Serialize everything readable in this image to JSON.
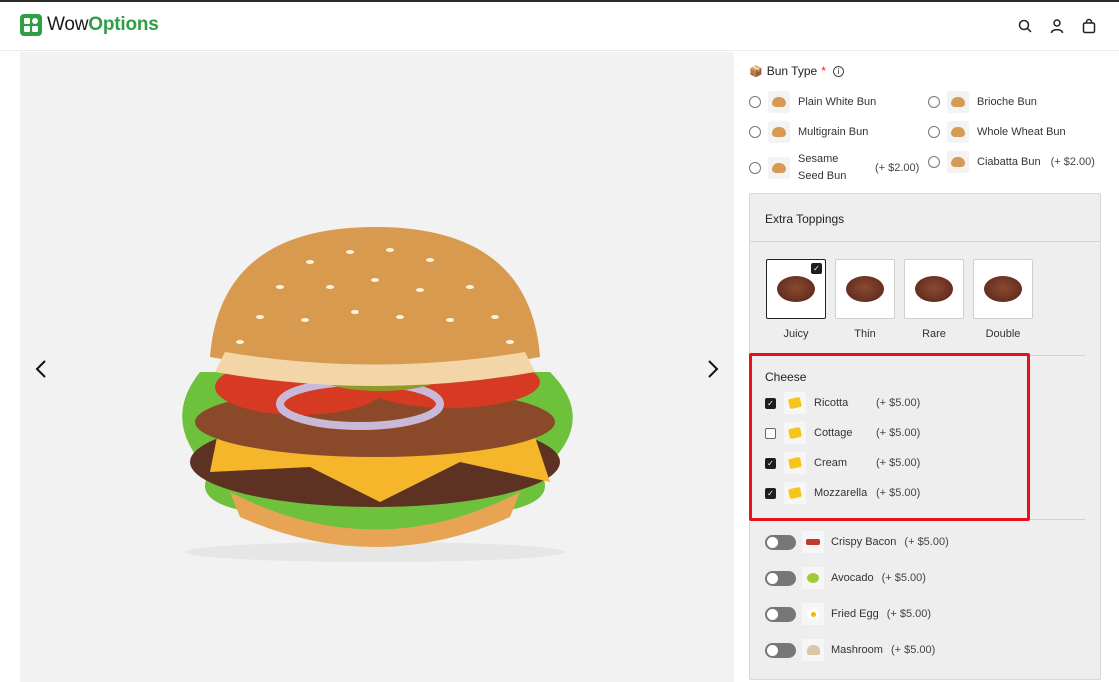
{
  "brand": {
    "prefix": "Wow",
    "accent": "Options",
    "color": "#2f9e44"
  },
  "header": {
    "icons": [
      "search-icon",
      "user-icon",
      "cart-icon"
    ]
  },
  "gallery": {
    "prev_icon": "chevron-left-icon",
    "next_icon": "chevron-right-icon"
  },
  "bun": {
    "label": "Bun Type",
    "required": "*",
    "options": [
      {
        "label": "Plain White Bun",
        "price": ""
      },
      {
        "label": "Brioche Bun",
        "price": ""
      },
      {
        "label": "Multigrain Bun",
        "price": ""
      },
      {
        "label": "Whole Wheat Bun",
        "price": ""
      },
      {
        "label": "Sesame Seed Bun",
        "price": "(+ $2.00)"
      },
      {
        "label": "Ciabatta Bun",
        "price": "(+ $2.00)"
      }
    ]
  },
  "toppings": {
    "title": "Extra Toppings",
    "patties": [
      {
        "label": "Juicy",
        "selected": true
      },
      {
        "label": "Thin",
        "selected": false
      },
      {
        "label": "Rare",
        "selected": false
      },
      {
        "label": "Double",
        "selected": false
      }
    ],
    "cheese": {
      "title": "Cheese",
      "items": [
        {
          "label": "Ricotta",
          "price": "(+ $5.00)",
          "checked": true
        },
        {
          "label": "Cottage",
          "price": "(+ $5.00)",
          "checked": false
        },
        {
          "label": "Cream",
          "price": "(+ $5.00)",
          "checked": true
        },
        {
          "label": "Mozzarella",
          "price": "(+ $5.00)",
          "checked": true
        }
      ]
    },
    "extras": [
      {
        "label": "Crispy Bacon",
        "price": "(+ $5.00)",
        "on": false
      },
      {
        "label": "Avocado",
        "price": "(+ $5.00)",
        "on": false
      },
      {
        "label": "Fried Egg",
        "price": "(+ $5.00)",
        "on": false
      },
      {
        "label": "Mashroom",
        "price": "(+ $5.00)",
        "on": false
      }
    ]
  },
  "colors": {
    "highlight": "#e8111b",
    "required": "#d32f2f"
  }
}
